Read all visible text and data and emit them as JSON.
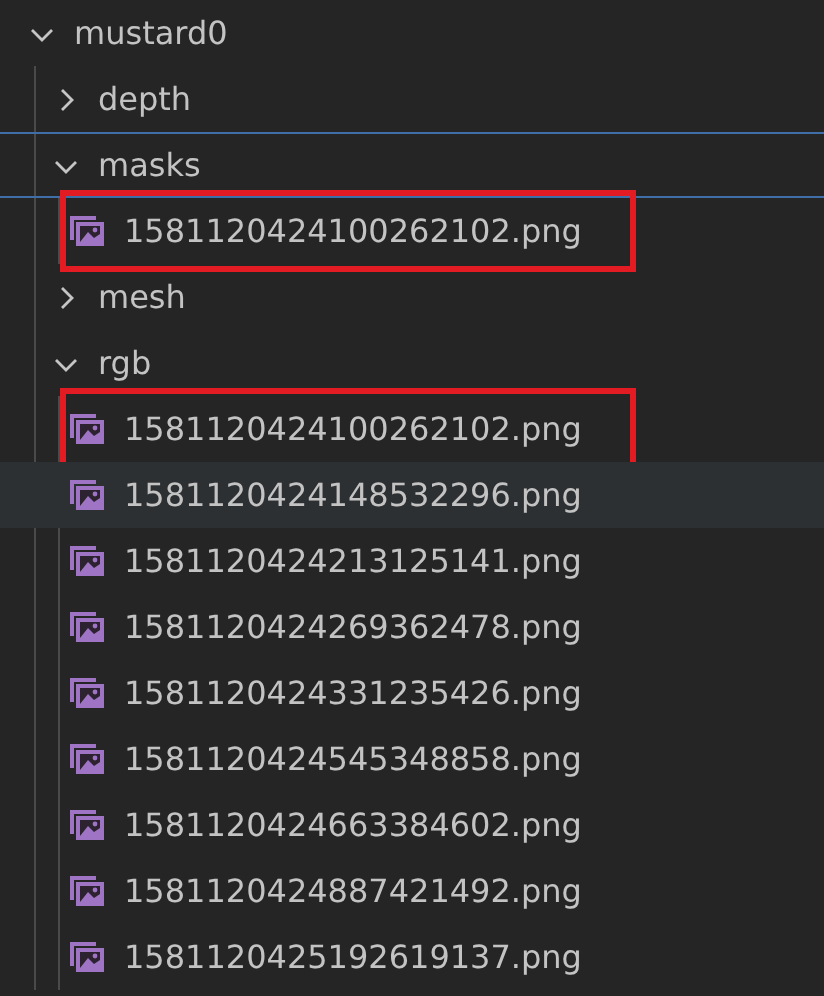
{
  "tree": [
    {
      "name": "mustard0",
      "kind": "folder",
      "expanded": true,
      "focused": false,
      "hovered": false,
      "highlighted": false,
      "children": [
        {
          "name": "depth",
          "kind": "folder",
          "expanded": false,
          "focused": false,
          "hovered": false,
          "highlighted": false
        },
        {
          "name": "masks",
          "kind": "folder",
          "expanded": true,
          "focused": true,
          "hovered": false,
          "highlighted": false,
          "children": [
            {
              "name": "1581120424100262102.png",
              "kind": "file",
              "focused": false,
              "hovered": false,
              "highlighted": true
            }
          ]
        },
        {
          "name": "mesh",
          "kind": "folder",
          "expanded": false,
          "focused": false,
          "hovered": false,
          "highlighted": false
        },
        {
          "name": "rgb",
          "kind": "folder",
          "expanded": true,
          "focused": false,
          "hovered": false,
          "highlighted": false,
          "children": [
            {
              "name": "1581120424100262102.png",
              "kind": "file",
              "focused": false,
              "hovered": false,
              "highlighted": true
            },
            {
              "name": "1581120424148532296.png",
              "kind": "file",
              "focused": false,
              "hovered": true,
              "highlighted": false
            },
            {
              "name": "1581120424213125141.png",
              "kind": "file",
              "focused": false,
              "hovered": false,
              "highlighted": false
            },
            {
              "name": "1581120424269362478.png",
              "kind": "file",
              "focused": false,
              "hovered": false,
              "highlighted": false
            },
            {
              "name": "1581120424331235426.png",
              "kind": "file",
              "focused": false,
              "hovered": false,
              "highlighted": false
            },
            {
              "name": "1581120424545348858.png",
              "kind": "file",
              "focused": false,
              "hovered": false,
              "highlighted": false
            },
            {
              "name": "1581120424663384602.png",
              "kind": "file",
              "focused": false,
              "hovered": false,
              "highlighted": false
            },
            {
              "name": "1581120424887421492.png",
              "kind": "file",
              "focused": false,
              "hovered": false,
              "highlighted": false
            },
            {
              "name": "1581120425192619137.png",
              "kind": "file",
              "focused": false,
              "hovered": false,
              "highlighted": false
            }
          ]
        }
      ]
    }
  ]
}
